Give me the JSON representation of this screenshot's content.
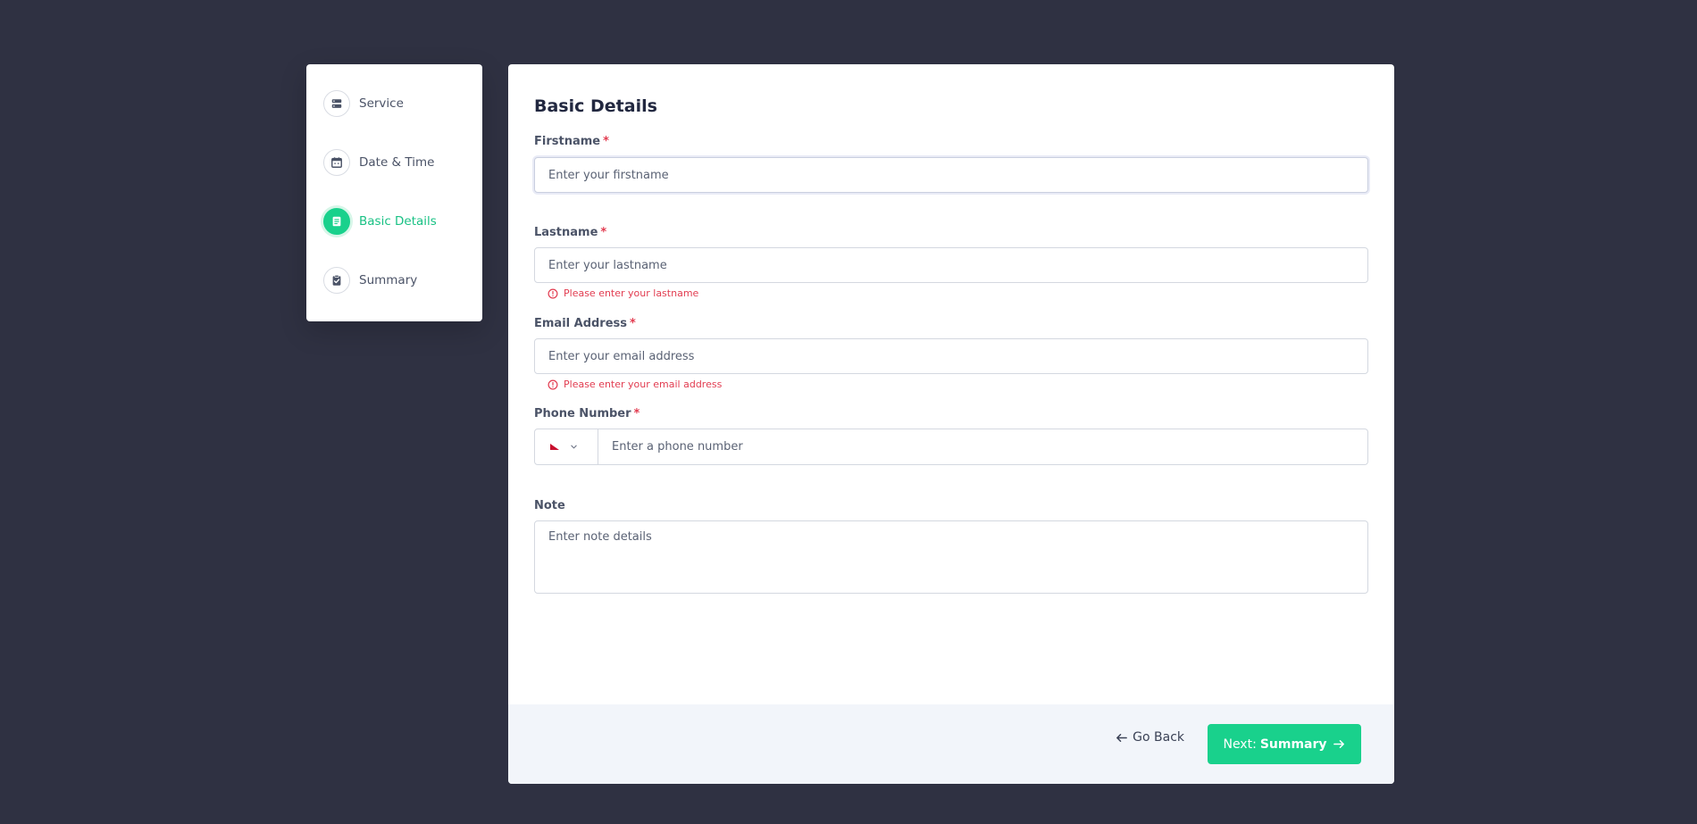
{
  "sidebar": {
    "steps": [
      {
        "label": "Service",
        "icon": "server-icon"
      },
      {
        "label": "Date & Time",
        "icon": "calendar-icon"
      },
      {
        "label": "Basic Details",
        "icon": "document-icon",
        "active": true
      },
      {
        "label": "Summary",
        "icon": "clipboard-check-icon"
      }
    ]
  },
  "form": {
    "title": "Basic Details",
    "required_mark": "*",
    "firstname": {
      "label": "Firstname",
      "placeholder": "Enter your firstname",
      "value": ""
    },
    "lastname": {
      "label": "Lastname",
      "placeholder": "Enter your lastname",
      "value": "",
      "error": "Please enter your lastname"
    },
    "email": {
      "label": "Email Address",
      "placeholder": "Enter your email address",
      "value": "",
      "error": "Please enter your email address"
    },
    "phone": {
      "label": "Phone Number",
      "placeholder": "Enter a phone number",
      "value": "",
      "country_flag": "flag-icon"
    },
    "note": {
      "label": "Note",
      "placeholder": "Enter note details",
      "value": ""
    }
  },
  "footer": {
    "back_label": "Go Back",
    "next_prefix": "Next:",
    "next_target": "Summary"
  },
  "colors": {
    "background": "#2f3142",
    "accent": "#19d18c",
    "error": "#e23c50",
    "footer_bg": "#f2f5fa"
  }
}
